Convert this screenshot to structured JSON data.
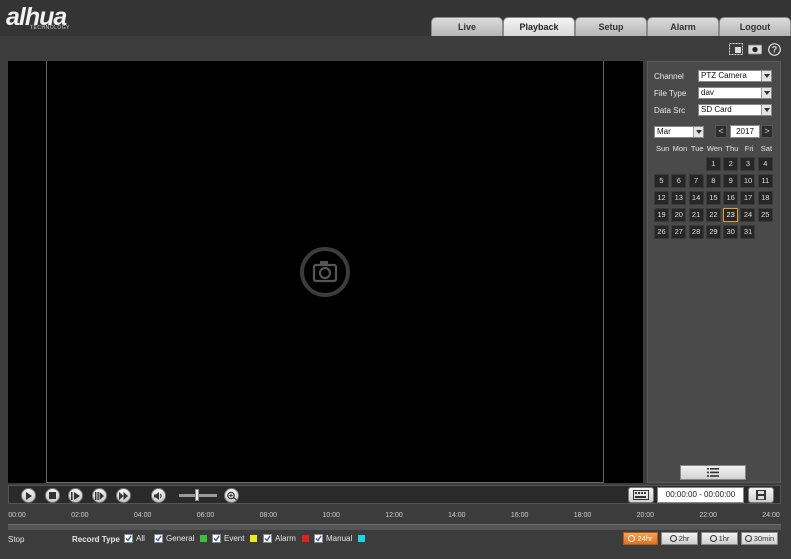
{
  "logo": {
    "brand": "alhua",
    "tagline": "TECHNOLOGY"
  },
  "nav": {
    "tabs": [
      {
        "label": "Live",
        "active": false
      },
      {
        "label": "Playback",
        "active": true
      },
      {
        "label": "Setup",
        "active": false
      },
      {
        "label": "Alarm",
        "active": false
      },
      {
        "label": "Logout",
        "active": false
      }
    ]
  },
  "top_icons": [
    "window-icon",
    "record-icon",
    "help-icon"
  ],
  "panel": {
    "channel": {
      "label": "Channel",
      "value": "PTZ Camera"
    },
    "file_type": {
      "label": "File Type",
      "value": "dav"
    },
    "data_src": {
      "label": "Data Src",
      "value": "SD Card"
    },
    "month": "Mar",
    "year": "2017",
    "prev": "<",
    "next": ">",
    "weekdays": [
      "Sun",
      "Mon",
      "Tue",
      "Wen",
      "Thu",
      "Fri",
      "Sat"
    ],
    "first_weekday_index": 3,
    "days_in_month": 31,
    "selected_day": 23
  },
  "controls": {
    "time_range": "00:00:00 - 00:00:00"
  },
  "timeline": {
    "ticks": [
      "00:00",
      "02:00",
      "04:00",
      "06:00",
      "08:00",
      "10:00",
      "12:00",
      "14:00",
      "16:00",
      "18:00",
      "20:00",
      "22:00",
      "24:00"
    ]
  },
  "bottom": {
    "status": "Stop",
    "record_type_label": "Record Type",
    "types": [
      {
        "label": "All",
        "checked": true,
        "color": ""
      },
      {
        "label": "General",
        "checked": true,
        "color": "#3fbf3f"
      },
      {
        "label": "Event",
        "checked": true,
        "color": "#e8e81a"
      },
      {
        "label": "Alarm",
        "checked": true,
        "color": "#e02020"
      },
      {
        "label": "Manual",
        "checked": true,
        "color": "#1ad8e0"
      }
    ],
    "zoom": [
      {
        "label": "24hr",
        "active": true
      },
      {
        "label": "2hr",
        "active": false
      },
      {
        "label": "1hr",
        "active": false
      },
      {
        "label": "30min",
        "active": false
      }
    ]
  }
}
